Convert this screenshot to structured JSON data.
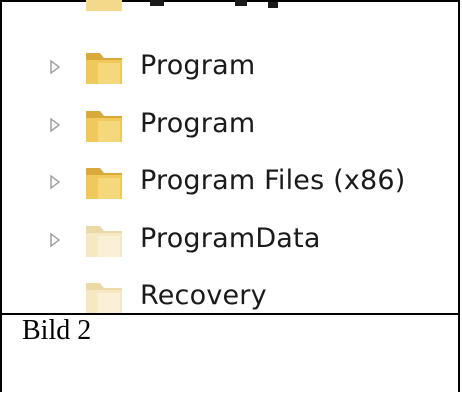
{
  "tree": {
    "items": [
      {
        "label": "",
        "has_expander": false,
        "icon": "folder-icon"
      },
      {
        "label": "Program",
        "has_expander": true,
        "icon": "folder-icon"
      },
      {
        "label": "Program",
        "has_expander": true,
        "icon": "folder-icon"
      },
      {
        "label": "Program Files (x86)",
        "has_expander": true,
        "icon": "folder-icon"
      },
      {
        "label": "ProgramData",
        "has_expander": true,
        "icon": "folder-icon"
      },
      {
        "label": "Recovery",
        "has_expander": false,
        "icon": "folder-icon"
      }
    ]
  },
  "caption": "Bild 2"
}
